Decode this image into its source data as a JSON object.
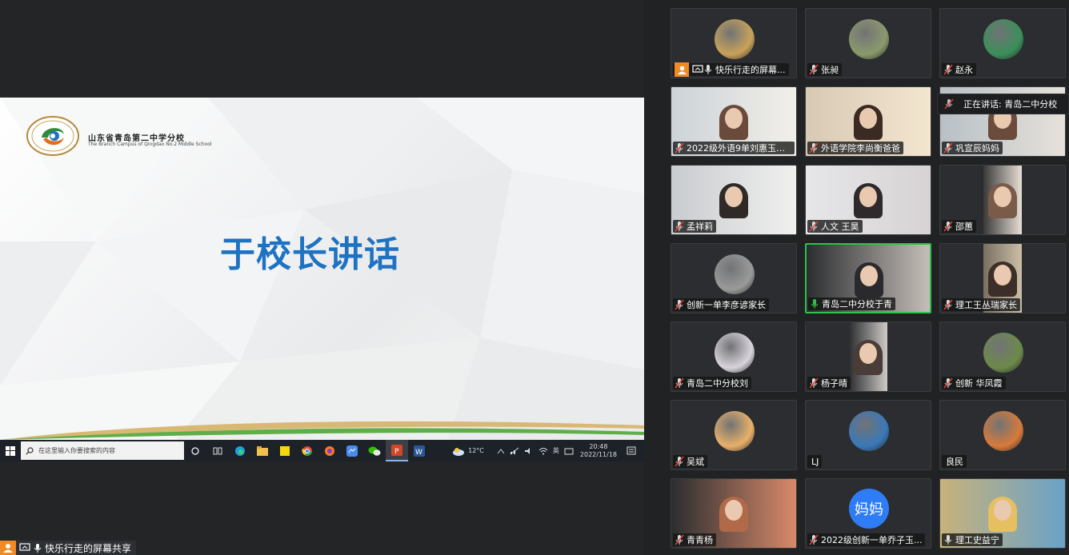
{
  "slide": {
    "school_name_cn": "山东省青岛第二中学分校",
    "school_name_en": "The Branch Campus of Qingdao No.2 Middle School",
    "title": "于校长讲话"
  },
  "taskbar": {
    "search_placeholder": "在这里输入你要搜索的内容",
    "weather": "12°C",
    "ime": "英",
    "time": "20:48",
    "date": "2022/11/18"
  },
  "share_status": {
    "label": "快乐行走的屏幕共享"
  },
  "speaker_indicator": {
    "text": "正在讲话: 青岛二中分校"
  },
  "participants": [
    {
      "name": "快乐行走的屏幕...",
      "kind": "avatar",
      "avatar_color": "#c9a25a",
      "mic": "on"
    },
    {
      "name": "张昶",
      "kind": "avatar",
      "avatar_color": "#8a9a6c",
      "mic": "muted"
    },
    {
      "name": "赵永",
      "kind": "avatar",
      "avatar_color": "#3a8f5a",
      "mic": "muted"
    },
    {
      "name": "2022级外语9单刘惠玉妈...",
      "kind": "video",
      "mic": "muted"
    },
    {
      "name": "外语学院李尚衡爸爸",
      "kind": "video",
      "mic": "muted"
    },
    {
      "name": "巩宣辰妈妈",
      "kind": "video",
      "mic": "muted"
    },
    {
      "name": "孟祥莉",
      "kind": "video",
      "mic": "muted"
    },
    {
      "name": "人文 王昊",
      "kind": "video",
      "mic": "muted"
    },
    {
      "name": "邵蕙",
      "kind": "video",
      "mic": "muted"
    },
    {
      "name": "创新一单李彦谚家长",
      "kind": "avatar",
      "avatar_color": "#9a9a9a",
      "mic": "muted"
    },
    {
      "name": "青岛二中分校于青",
      "kind": "video",
      "mic": "speaking"
    },
    {
      "name": "理工王丛瑞家长",
      "kind": "video",
      "mic": "muted"
    },
    {
      "name": "青岛二中分校刘",
      "kind": "avatar",
      "avatar_color": "#d8d4dc",
      "mic": "muted"
    },
    {
      "name": "杨子晴",
      "kind": "video",
      "mic": "muted"
    },
    {
      "name": "创新 华凤霞",
      "kind": "avatar",
      "avatar_color": "#6c8a4a",
      "mic": "muted"
    },
    {
      "name": "吴斌",
      "kind": "avatar",
      "avatar_color": "#e8b06a",
      "mic": "muted"
    },
    {
      "name": "LJ",
      "kind": "avatar",
      "avatar_color": "#3a78b8",
      "mic": "none"
    },
    {
      "name": "良民",
      "kind": "avatar",
      "avatar_color": "#d87a3a",
      "mic": "none"
    },
    {
      "name": "青青杨",
      "kind": "video",
      "mic": "muted"
    },
    {
      "name": "2022级创新一单乔子玉...",
      "kind": "initials",
      "initials": "妈妈",
      "mic": "muted"
    },
    {
      "name": "理工史益宁",
      "kind": "video",
      "mic": "on"
    }
  ]
}
